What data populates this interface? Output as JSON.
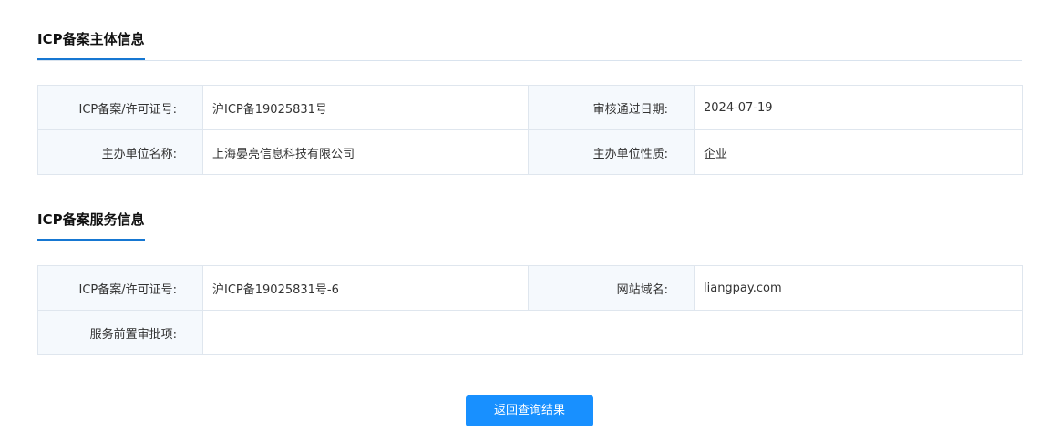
{
  "subject_section": {
    "title": "ICP备案主体信息",
    "rows": [
      {
        "label1": "ICP备案/许可证号:",
        "value1": "沪ICP备19025831号",
        "label2": "审核通过日期:",
        "value2": "2024-07-19"
      },
      {
        "label1": "主办单位名称:",
        "value1": "上海晏亮信息科技有限公司",
        "label2": "主办单位性质:",
        "value2": "企业"
      }
    ]
  },
  "service_section": {
    "title": "ICP备案服务信息",
    "rows": [
      {
        "label1": "ICP备案/许可证号:",
        "value1": "沪ICP备19025831号-6",
        "label2": "网站域名:",
        "value2": "liangpay.com"
      }
    ],
    "approval_label": "服务前置审批项:",
    "approval_value": ""
  },
  "actions": {
    "back_label": "返回查询结果"
  },
  "colors": {
    "accent": "#1677d2",
    "button": "#1890ff",
    "label_bg": "#f5f9fd",
    "border": "#dfe6ee"
  }
}
